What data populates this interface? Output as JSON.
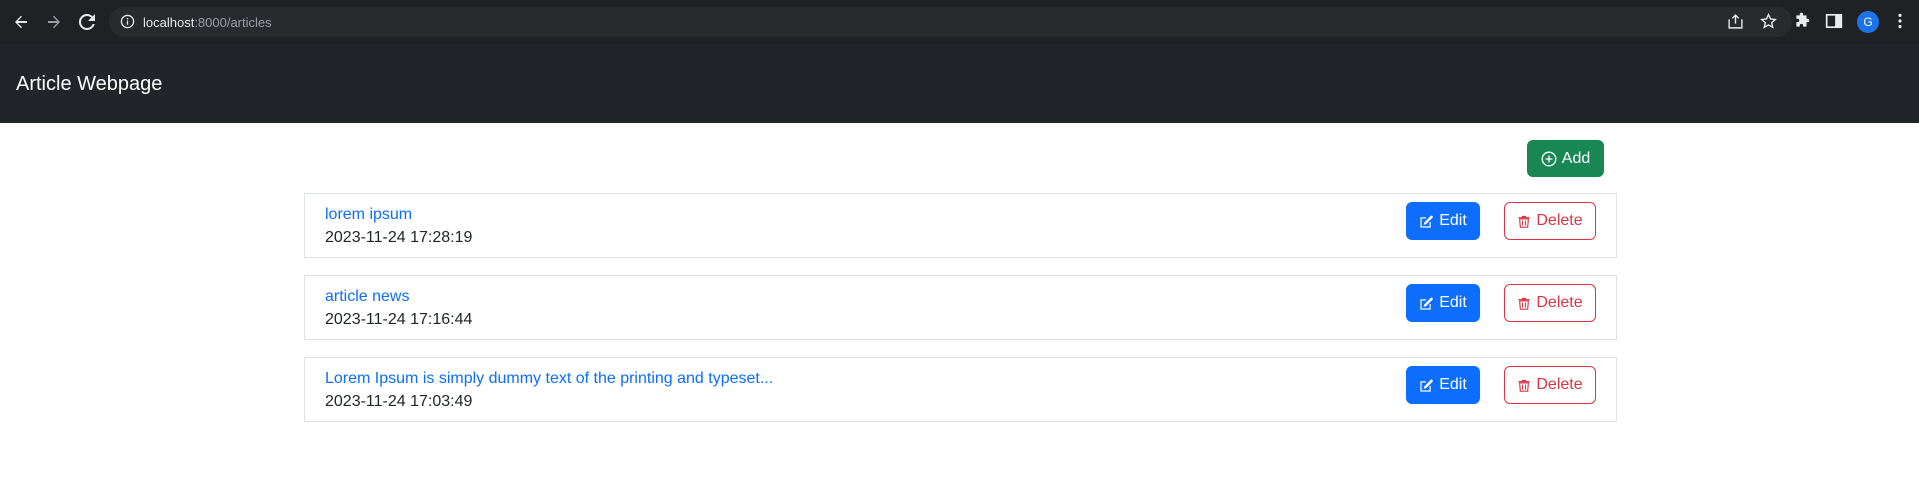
{
  "browser": {
    "url_host": "localhost",
    "url_path": ":8000/articles",
    "profile_initial": "G"
  },
  "navbar": {
    "brand": "Article Webpage"
  },
  "toolbar": {
    "add_label": "Add"
  },
  "articles": [
    {
      "title": "lorem ipsum",
      "date": "2023-11-24 17:28:19",
      "edit_label": "Edit",
      "delete_label": "Delete"
    },
    {
      "title": "article news",
      "date": "2023-11-24 17:16:44",
      "edit_label": "Edit",
      "delete_label": "Delete"
    },
    {
      "title": "Lorem Ipsum is simply dummy text of the printing and typeset...",
      "date": "2023-11-24 17:03:49",
      "edit_label": "Edit",
      "delete_label": "Delete"
    }
  ],
  "colors": {
    "navbar_bg": "#212529",
    "add_green": "#198754",
    "edit_blue": "#0d6efd",
    "delete_red": "#dc3545",
    "link_blue": "#0d6efd"
  },
  "icons": {
    "back": "arrow-left-icon",
    "forward": "arrow-right-icon",
    "reload": "reload-icon",
    "info": "info-icon",
    "share": "share-icon",
    "bookmark": "star-icon",
    "extensions": "puzzle-icon",
    "sidepanel": "side-panel-icon",
    "menu": "kebab-menu-icon",
    "add": "plus-circle-icon",
    "edit": "pencil-square-icon",
    "delete": "trash-icon"
  }
}
